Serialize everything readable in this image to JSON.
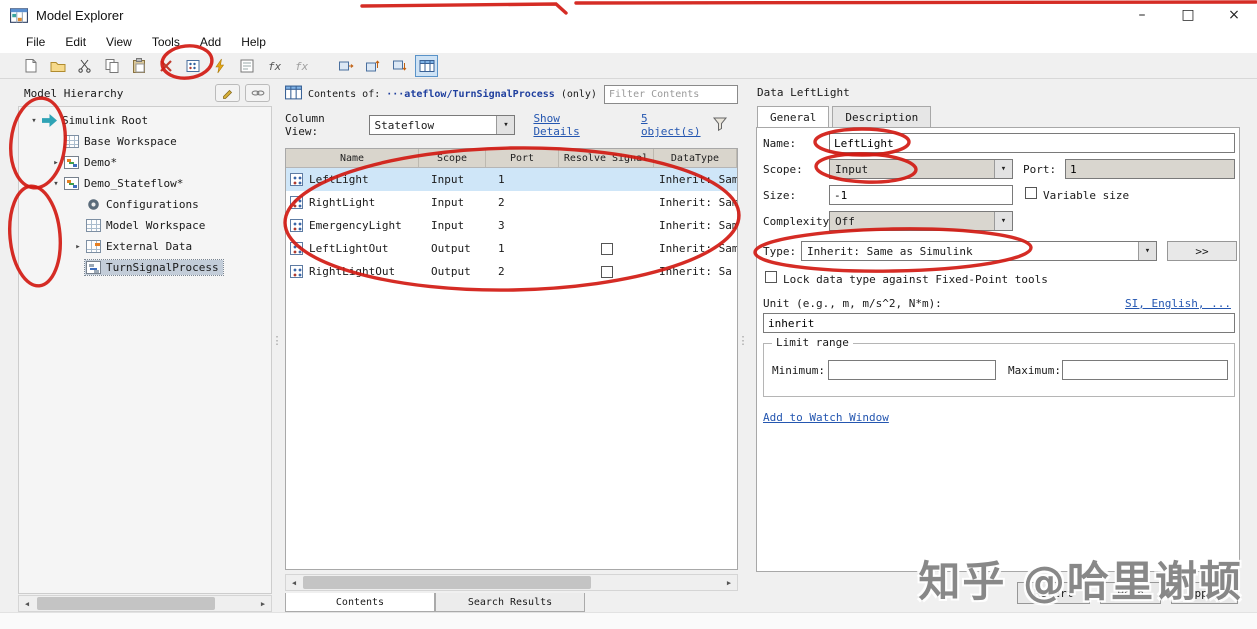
{
  "colors": {
    "selection": "#cfe6f8",
    "tree_selection": "#c3cdd9",
    "link": "#2456b0",
    "annotation": "#d11a12",
    "path_text": "#1f3f9e"
  },
  "window": {
    "title": "Model Explorer",
    "minimize": "–",
    "maximize": "□",
    "close": "×"
  },
  "menu": {
    "items": [
      {
        "label": "File"
      },
      {
        "label": "Edit"
      },
      {
        "label": "View"
      },
      {
        "label": "Tools"
      },
      {
        "label": "Add"
      },
      {
        "label": "Help"
      }
    ]
  },
  "toolbar": {
    "icons": [
      "new-object",
      "open",
      "cut",
      "copy",
      "paste",
      "delete",
      "add-data",
      "add-event",
      "dialog-pane",
      "function",
      "function-call",
      "trace-selected",
      "trace-up",
      "trace-down",
      "column-view"
    ]
  },
  "hierarchy": {
    "title": "Model Hierarchy",
    "items": [
      {
        "label": "Simulink Root",
        "level": 0,
        "expand": "open",
        "icon": "ico-root"
      },
      {
        "label": "Base Workspace",
        "level": 1,
        "expand": "none",
        "icon": "ico-grid"
      },
      {
        "label": "Demo*",
        "level": 1,
        "expand": "closed",
        "icon": "ico-model"
      },
      {
        "label": "Demo_Stateflow*",
        "level": 1,
        "expand": "open",
        "icon": "ico-model"
      },
      {
        "label": "Configurations",
        "level": 2,
        "expand": "none",
        "icon": "ico-config"
      },
      {
        "label": "Model Workspace",
        "level": 2,
        "expand": "none",
        "icon": "ico-grid"
      },
      {
        "label": "External Data",
        "level": 2,
        "expand": "closed",
        "icon": "ico-data"
      },
      {
        "label": "TurnSignalProcess",
        "level": 2,
        "expand": "none",
        "icon": "ico-chart",
        "selected": true
      }
    ]
  },
  "contents": {
    "of_label": "Contents of:",
    "path": "···ateflow/TurnSignalProcess",
    "only": "(only)",
    "filter_placeholder": "Filter Contents",
    "column_view_label": "Column View:",
    "column_view_value": "Stateflow",
    "show_details_link": "Show Details",
    "object_count_link": "5 object(s)",
    "table": {
      "columns": [
        "Name",
        "Scope",
        "Port",
        "Resolve Signal",
        "DataType"
      ],
      "rows": [
        {
          "name": "LeftLight",
          "scope": "Input",
          "port": "1",
          "resolve": "none",
          "data": "Inherit: Sam",
          "selected": true
        },
        {
          "name": "RightLight",
          "scope": "Input",
          "port": "2",
          "resolve": "none",
          "data": "Inherit: Sam"
        },
        {
          "name": "EmergencyLight",
          "scope": "Input",
          "port": "3",
          "resolve": "none",
          "data": "Inherit: Sam"
        },
        {
          "name": "LeftLightOut",
          "scope": "Output",
          "port": "1",
          "resolve": "unchecked",
          "data": "Inherit: Sam"
        },
        {
          "name": "RightLightOut",
          "scope": "Output",
          "port": "2",
          "resolve": "unchecked",
          "data": "Inherit: Sa"
        }
      ]
    },
    "bottom_tabs": [
      {
        "label": "Contents",
        "active": true
      },
      {
        "label": "Search Results"
      }
    ]
  },
  "inspector": {
    "title": "Data LeftLight",
    "tabs": [
      {
        "label": "General",
        "active": true
      },
      {
        "label": "Description"
      }
    ],
    "name_label": "Name:",
    "name_value": "LeftLight",
    "scope_label": "Scope:",
    "scope_value": "Input",
    "port_label": "Port:",
    "port_value": "1",
    "size_label": "Size:",
    "size_value": "-1",
    "variable_size_label": "Variable size",
    "complexity_label": "Complexity:",
    "complexity_value": "Off",
    "type_label": "Type:",
    "type_value": "Inherit: Same as Simulink",
    "type_expand_button": ">>",
    "lock_label": "Lock data type against Fixed-Point tools",
    "unit_label": "Unit (e.g., m, m/s^2, N*m):",
    "unit_links": "SI, English, ...",
    "unit_value": "inherit",
    "limit_group_label": "Limit range",
    "minimum_label": "Minimum:",
    "maximum_label": "Maximum:",
    "watch_link": "Add to Watch Window",
    "buttons": [
      {
        "label": "Revert"
      },
      {
        "label": "Help"
      },
      {
        "label": "Apply"
      }
    ]
  },
  "watermark": "知乎 @哈里谢顿"
}
